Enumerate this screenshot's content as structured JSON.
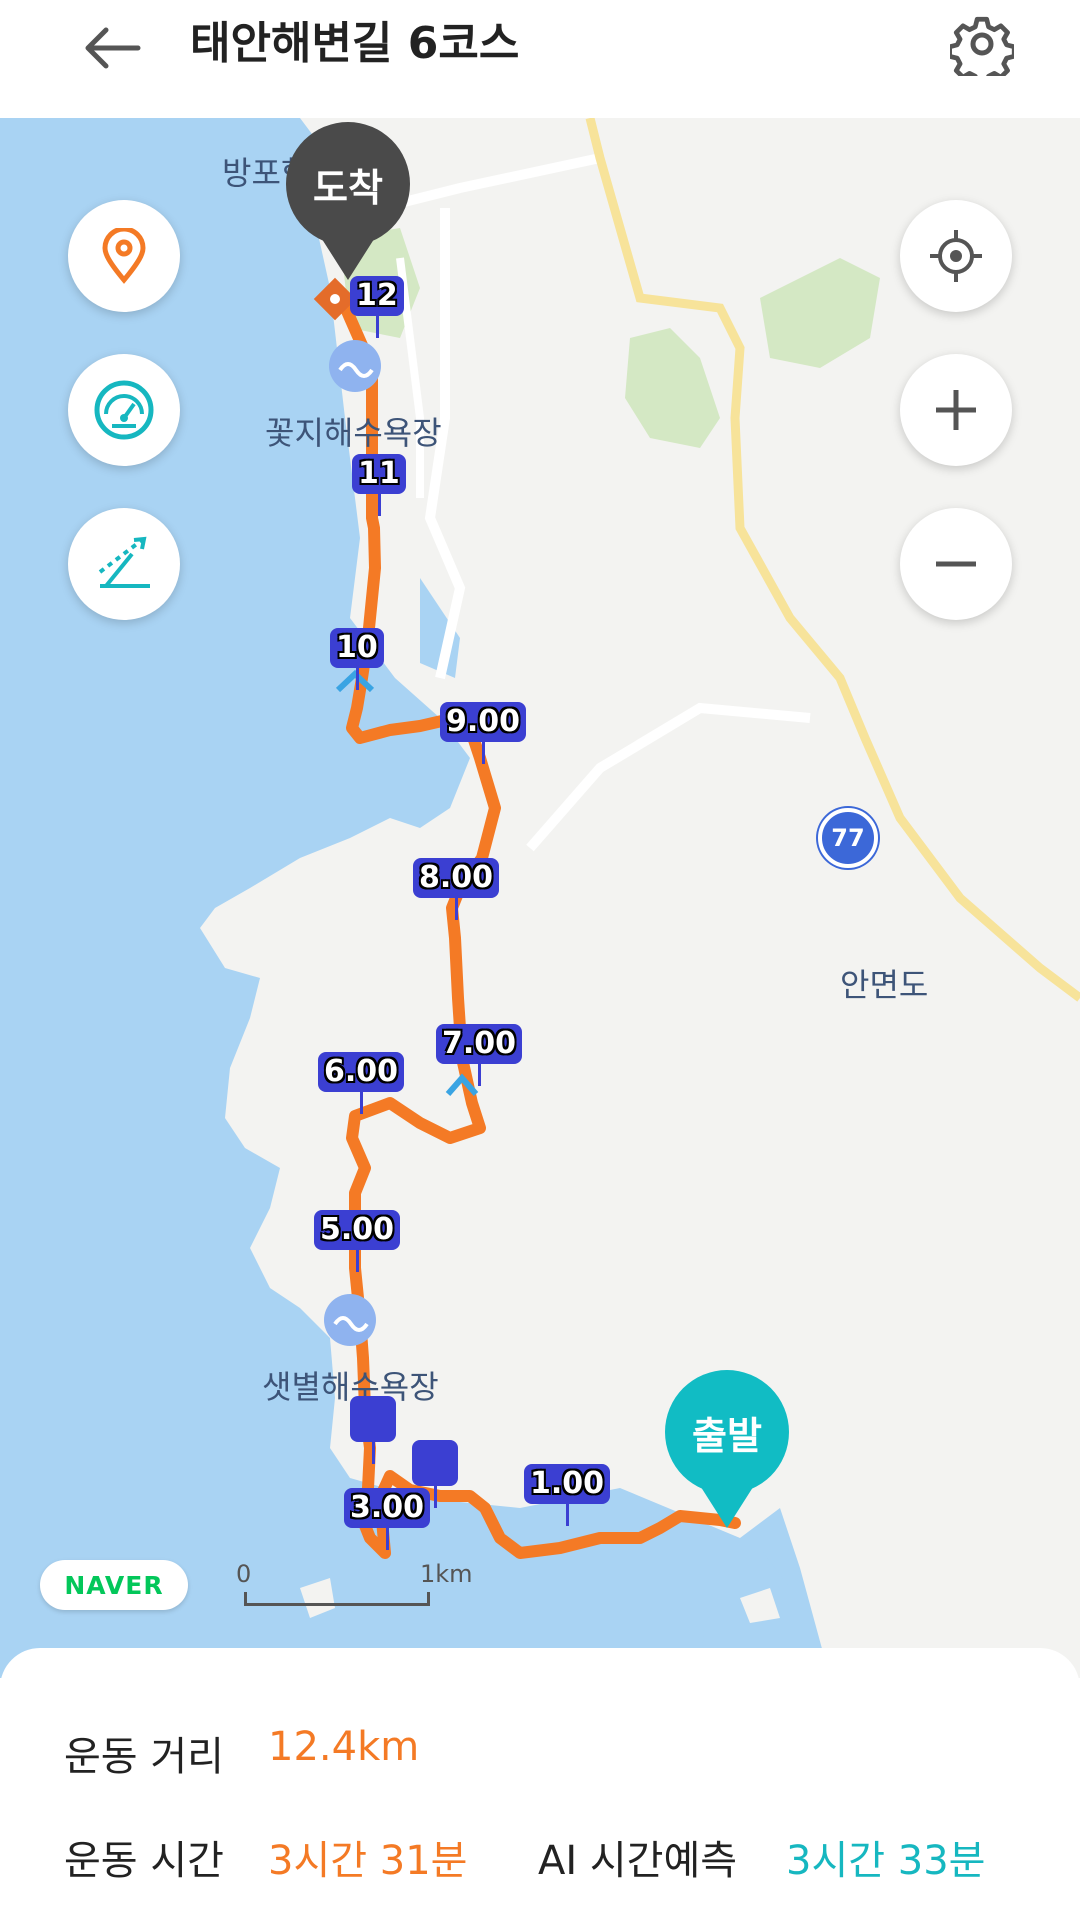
{
  "header": {
    "back_icon": "arrow-left-icon",
    "title": "태안해변길 6코스",
    "settings_icon": "gear-icon"
  },
  "map": {
    "labels": {
      "bangpo": "방포항",
      "kkotji_beach": "꽃지해수욕장",
      "saetbyeol_beach": "샛별해수욕장",
      "anmyeondo": "안면도"
    },
    "route_number": "77",
    "pins": {
      "finish": "도착",
      "start": "출발"
    },
    "markers": [
      "12",
      "11",
      "10",
      "9.00",
      "8.00",
      "7.00",
      "6.00",
      "5.00",
      "3.00",
      "1.00"
    ],
    "left_controls": [
      {
        "name": "location-pin-button",
        "icon": "location-pin-icon"
      },
      {
        "name": "speedometer-button",
        "icon": "speedometer-icon"
      },
      {
        "name": "elevation-button",
        "icon": "elevation-slope-icon"
      }
    ],
    "right_controls": [
      {
        "name": "my-location-button",
        "icon": "crosshair-icon"
      },
      {
        "name": "zoom-in-button",
        "icon": "plus-icon"
      },
      {
        "name": "zoom-out-button",
        "icon": "minus-icon"
      }
    ],
    "brand": "NAVER",
    "scale": {
      "start": "0",
      "end": "1km"
    },
    "colors": {
      "sea": "#a9d3f3",
      "land": "#f3f3f1",
      "route": "#f47a25",
      "marker": "#3b3fd2",
      "road": "#f7e39a"
    }
  },
  "stats": {
    "distance_label": "운동 거리",
    "distance_value": "12.4km",
    "time_label": "운동 시간",
    "time_value": "3시간 31분",
    "ai_label": "AI 시간예측",
    "ai_value": "3시간 33분"
  }
}
